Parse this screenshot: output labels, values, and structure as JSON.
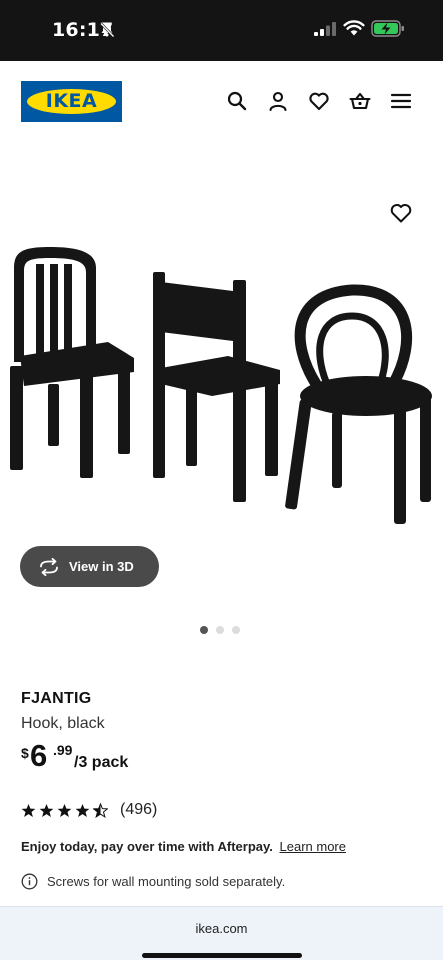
{
  "status_bar": {
    "time": "16:17",
    "icons": [
      "bell-off-icon",
      "signal-icon",
      "wifi-icon",
      "battery-charging-icon"
    ]
  },
  "header": {
    "logo_text": "IKEA",
    "icons": [
      "search-icon",
      "account-icon",
      "favourites-icon",
      "basket-icon",
      "menu-icon"
    ]
  },
  "gallery": {
    "view_3d_label": "View in 3D",
    "page_count": 3,
    "active_page": 1
  },
  "product": {
    "name": "FJANTIG",
    "description": "Hook, black",
    "price": {
      "currency": "$",
      "whole": "6",
      "decimal": ".99",
      "unit": "/3 pack"
    },
    "rating": {
      "stars": 4.5,
      "count_label": "(496)"
    }
  },
  "afterpay": {
    "text": "Enjoy today, pay over time with Afterpay.",
    "link_label": "Learn more"
  },
  "note": "Screws for wall mounting sold separately.",
  "browser": {
    "url": "ikea.com"
  },
  "colors": {
    "ikea_blue": "#0058a3",
    "ikea_yellow": "#ffdb00",
    "status_bar": "#141414",
    "battery_green": "#34c759",
    "pill_bg": "#4a4a4a"
  }
}
